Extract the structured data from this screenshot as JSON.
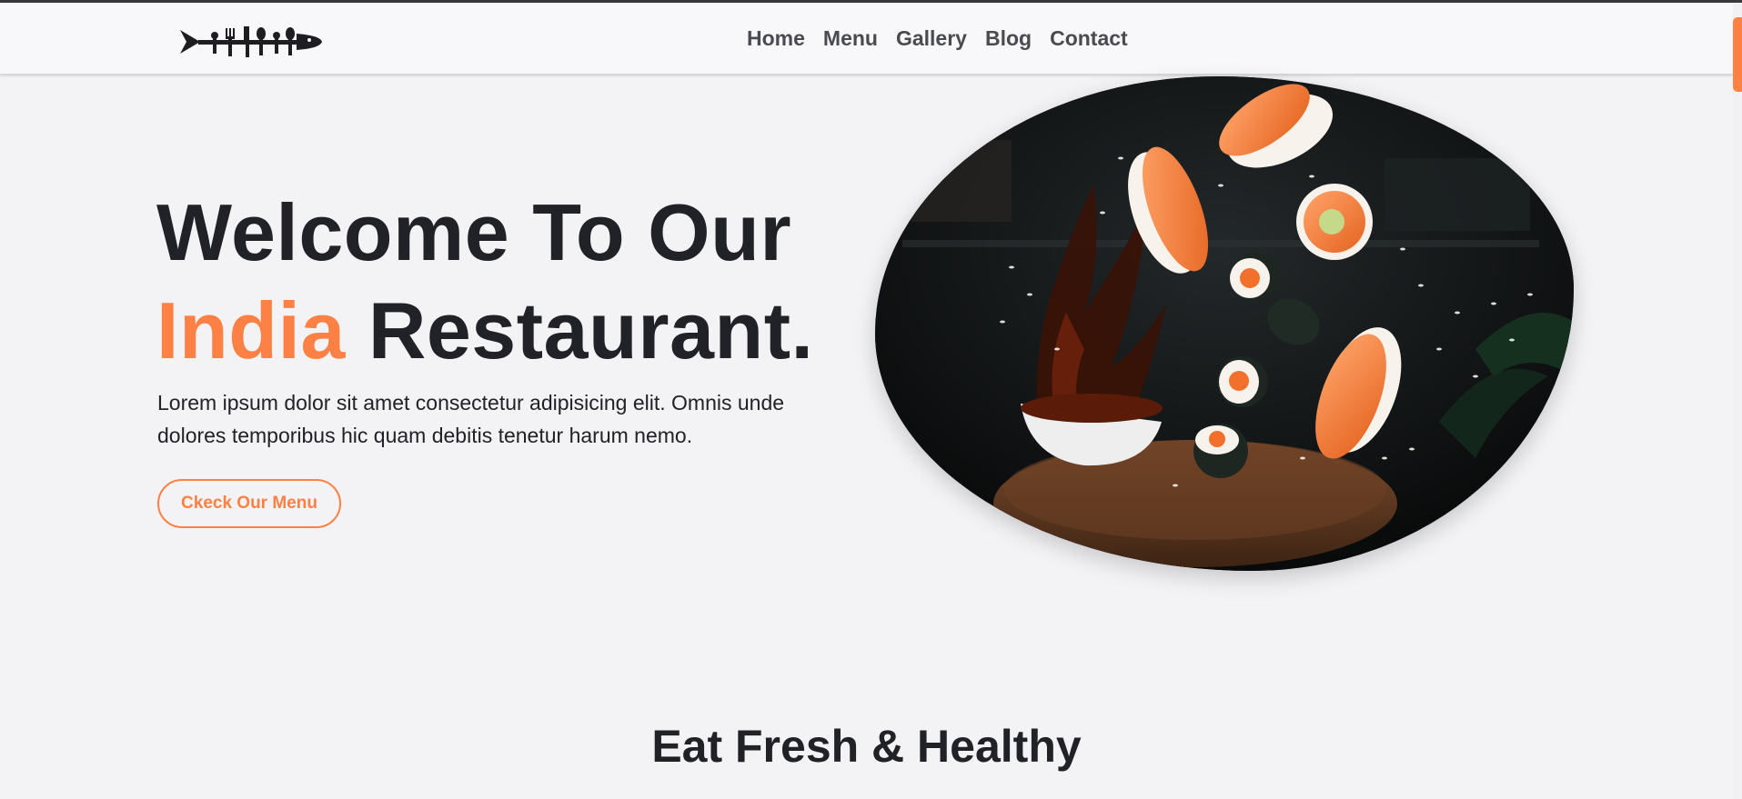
{
  "nav": {
    "logo_icon": "cutlery-fish-logo-icon",
    "links": [
      "Home",
      "Menu",
      "Gallery",
      "Blog",
      "Contact"
    ]
  },
  "hero": {
    "title_line1": "Welcome To Our",
    "title_accent": "India",
    "title_rest": "Restaurant.",
    "description": "Lorem ipsum dolor sit amet consectetur adipisicing elit. Omnis unde dolores temporibus hic quam debitis tenetur harum nemo.",
    "button_label": "Ckeck Our Menu",
    "image_icon": "flying-sushi-image"
  },
  "section": {
    "title": "Eat Fresh & Healthy"
  },
  "colors": {
    "accent": "#fd8144",
    "text": "#212227",
    "nav_text": "#4a4b52",
    "background": "#f3f2f5"
  }
}
